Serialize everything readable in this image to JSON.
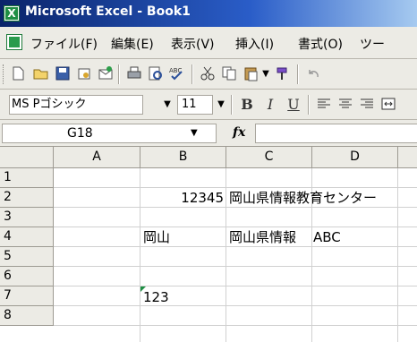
{
  "window": {
    "title": "Microsoft Excel - Book1",
    "icon_letter": "X"
  },
  "menu": {
    "items": [
      "ファイル(F)",
      "編集(E)",
      "表示(V)",
      "挿入(I)",
      "書式(O)",
      "ツー"
    ]
  },
  "toolbar": {
    "font_name": "MS Pゴシック",
    "font_size": "11",
    "bold_label": "B",
    "italic_label": "I",
    "underline_label": "U"
  },
  "formula_bar": {
    "name_box": "G18",
    "fx_label": "fx",
    "formula": ""
  },
  "sheet": {
    "columns": [
      "A",
      "B",
      "C",
      "D"
    ],
    "rows": [
      "1",
      "2",
      "3",
      "4",
      "5",
      "6",
      "7",
      "8"
    ],
    "cells": {
      "B2": "12345",
      "C2": "岡山県情報教育センター",
      "B4": "岡山",
      "C4": "岡山県情報",
      "D4": "ABC",
      "B7": "123"
    }
  }
}
